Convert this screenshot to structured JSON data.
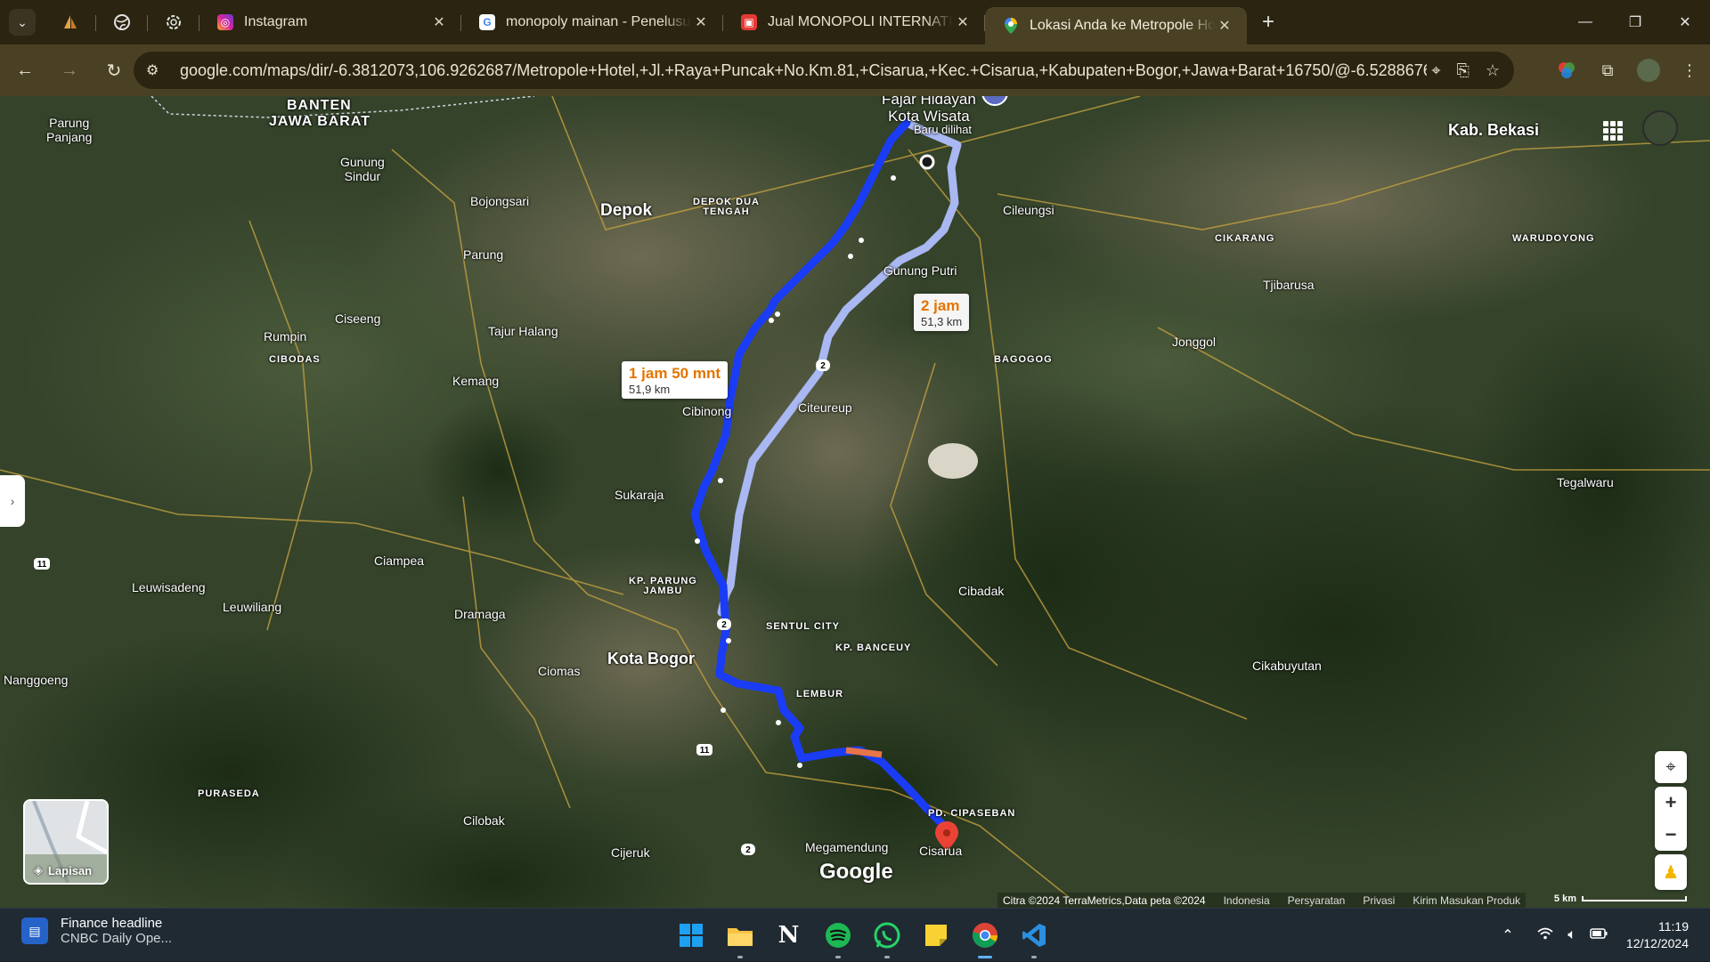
{
  "browser": {
    "tabs": [
      {
        "title": "Instagram",
        "favicon": "instagram-icon",
        "color": "#d6249f",
        "active": false
      },
      {
        "title": "monopoly mainan - Penelusuran",
        "favicon": "google-icon",
        "color": "#4285f4",
        "active": false
      },
      {
        "title": "Jual MONOPOLI INTERNATIONAL",
        "favicon": "shop-bag-icon",
        "color": "#e53935",
        "active": false
      },
      {
        "title": "Lokasi Anda ke Metropole Hotel",
        "favicon": "maps-pin-icon",
        "color": "#34a853",
        "active": true
      }
    ],
    "url": "google.com/maps/dir/-6.3812073,106.9262687/Metropole+Hotel,+Jl.+Raya+Puncak+No.Km.81,+Cisarua,+Kec.+Cisarua,+Kabupaten+Bogor,+Jawa+Barat+16750/@-6.5288676..."
  },
  "map": {
    "routes": {
      "primary": {
        "time": "1 jam 50 mnt",
        "distance": "51,9 km"
      },
      "alternate": {
        "time": "2 jam",
        "distance": "51,3 km"
      }
    },
    "labels": {
      "banten": "BANTEN",
      "jawa_barat": "JAWA BARAT",
      "parung_panjang": "Parung\nPanjang",
      "gunung_sindur": "Gunung\nSindur",
      "bojongsari": "Bojongsari",
      "depok": "Depok",
      "depok_dua": "DEPOK DUA\nTENGAH",
      "fajar": "Fajar Hidayah\nKota Wisata",
      "baru_dilihat": "Baru dilihat",
      "kab_bekasi": "Kab. Bekasi",
      "cileungsi": "Cileungsi",
      "cikarang": "CIKARANG",
      "warudoyong": "WARUDOYONG",
      "parung": "Parung",
      "gunung_putri": "Gunung Putri",
      "tjibarusa": "Tjibarusa",
      "rumpin": "Rumpin",
      "ciseeng": "Ciseeng",
      "tajur_halang": "Tajur Halang",
      "cibodas": "CIBODAS",
      "bagogog": "BAGOGOG",
      "jonggol": "Jonggol",
      "kemang": "Kemang",
      "cibinong": "Cibinong",
      "citeureup": "Citeureup",
      "tegalwaru": "Tegalwaru",
      "sukaraja": "Sukaraja",
      "ciampea": "Ciampea",
      "leuwisadeng": "Leuwisadeng",
      "leuwiliang": "Leuwiliang",
      "kp_parung_jambu": "KP. PARUNG\nJAMBU",
      "cibadak": "Cibadak",
      "dramaga": "Dramaga",
      "sentul_city": "SENTUL CITY",
      "kp_banceuy": "KP. BANCEUY",
      "kota_bogor": "Kota Bogor",
      "ciomas": "Ciomas",
      "cikabuyutan": "Cikabuyutan",
      "nanggoeng": "Nanggoeng",
      "lembur": "LEMBUR",
      "puraseda": "PURASEDA",
      "pd_cipaseban": "PD. CIPASEBAN",
      "cilobak": "Cilobak",
      "megamendung": "Megamendung",
      "cisarua": "Cisarua",
      "cijeruk": "Cijeruk"
    },
    "road_shields": [
      "2",
      "2",
      "11",
      "11",
      "2"
    ],
    "layers_label": "Lapisan",
    "google_logo": "Google",
    "attribution": {
      "imagery": "Citra ©2024 TerraMetrics,Data peta ©2024",
      "links": [
        "Indonesia",
        "Persyaratan",
        "Privasi",
        "Kirim Masukan Produk"
      ],
      "scale": "5 km"
    },
    "colors": {
      "primary_route": "#1a3cf5",
      "alternate_route": "#a9b8f2",
      "destination": "#ea4335"
    }
  },
  "taskbar": {
    "news_title": "Finance headline",
    "news_sub": "CNBC Daily Ope...",
    "time": "11:19",
    "date": "12/12/2024",
    "apps": [
      {
        "name": "windows-start-icon",
        "running": false,
        "active": false,
        "color": "#1ea1f2",
        "glyph": "⊞"
      },
      {
        "name": "file-explorer-icon",
        "running": true,
        "active": false,
        "color": "#f6c343",
        "glyph": "▤"
      },
      {
        "name": "notion-icon",
        "running": false,
        "active": false,
        "color": "#202a33",
        "glyph": "N"
      },
      {
        "name": "spotify-icon",
        "running": true,
        "active": false,
        "color": "#1db954",
        "glyph": "≡"
      },
      {
        "name": "whatsapp-icon",
        "running": true,
        "active": false,
        "color": "#25d366",
        "glyph": "☎"
      },
      {
        "name": "sticky-notes-icon",
        "running": false,
        "active": false,
        "color": "#f7d232",
        "glyph": "◢"
      },
      {
        "name": "chrome-icon",
        "running": true,
        "active": true,
        "color": "#db4437",
        "glyph": "◉"
      },
      {
        "name": "vscode-icon",
        "running": true,
        "active": false,
        "color": "#2a8fe0",
        "glyph": "❯"
      }
    ]
  }
}
